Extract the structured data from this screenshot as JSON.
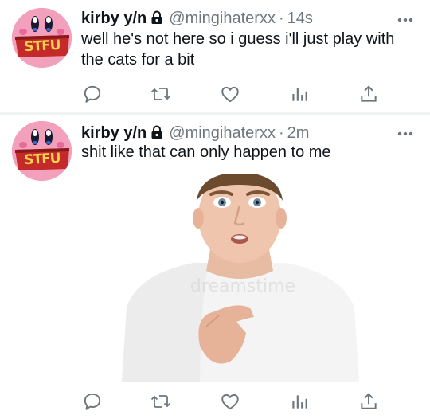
{
  "colors": {
    "text": "#0f1419",
    "secondary": "#6e767d",
    "avatar_bg": "#f2a0bb",
    "divider": "#eff3f4"
  },
  "tweets": [
    {
      "display_name": "kirby y/n",
      "protected_icon": "lock-icon",
      "handle": "@mingihaterxx",
      "separator": "·",
      "time": "14s",
      "text": "well he's not here so i guess i'll just play with the cats for a bit",
      "avatar_sign_text": "STFU",
      "actions": [
        "reply-icon",
        "retweet-icon",
        "like-icon",
        "analytics-icon",
        "share-icon"
      ]
    },
    {
      "display_name": "kirby y/n",
      "protected_icon": "lock-icon",
      "handle": "@mingihaterxx",
      "separator": "·",
      "time": "2m",
      "text": "shit like that can only happen to me",
      "avatar_sign_text": "STFU",
      "media": {
        "description_icon": "photo",
        "watermark": "dreamstime"
      },
      "actions": [
        "reply-icon",
        "retweet-icon",
        "like-icon",
        "analytics-icon",
        "share-icon"
      ]
    }
  ]
}
